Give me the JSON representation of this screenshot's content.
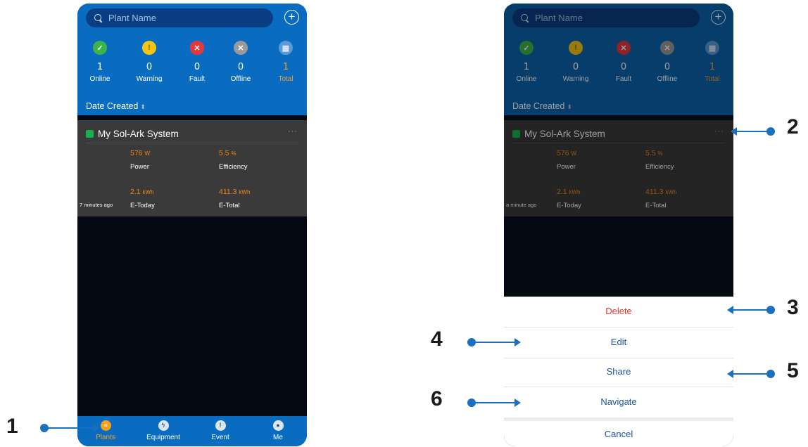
{
  "header": {
    "search_placeholder": "Plant Name",
    "add_icon": "plus-circle-icon"
  },
  "stats": [
    {
      "key": "online",
      "count": "1",
      "label": "Online",
      "icon": "check-icon",
      "color": "#3cb449"
    },
    {
      "key": "warning",
      "count": "0",
      "label": "Warning",
      "icon": "warning-icon",
      "color": "#f3c613"
    },
    {
      "key": "fault",
      "count": "0",
      "label": "Fault",
      "icon": "x-icon",
      "color": "#e5383b"
    },
    {
      "key": "offline",
      "count": "0",
      "label": "Offline",
      "icon": "x-icon",
      "color": "#9a9a9a"
    },
    {
      "key": "total",
      "count": "1",
      "label": "Total",
      "icon": "chart-icon",
      "color": "#5a9ad8"
    }
  ],
  "sort_label": "Date Created",
  "plant_left": {
    "name": "My Sol-Ark System",
    "menu": "···",
    "power_value": "576",
    "power_unit": "W",
    "power_label": "Power",
    "efficiency_value": "5.5",
    "efficiency_unit": "%",
    "efficiency_label": "Efficiency",
    "etoday_value": "2.1",
    "etoday_unit": "kWh",
    "etoday_label": "E-Today",
    "etotal_value": "411.3",
    "etotal_unit": "kWh",
    "etotal_label": "E-Total",
    "updated": "7 minutes ago"
  },
  "plant_right": {
    "name": "My Sol-Ark System",
    "menu": "···",
    "power_value": "576",
    "power_unit": "W",
    "power_label": "Power",
    "efficiency_value": "5.5",
    "efficiency_unit": "%",
    "efficiency_label": "Efficiency",
    "etoday_value": "2.1",
    "etoday_unit": "kWh",
    "etoday_label": "E-Today",
    "etotal_value": "411.3",
    "etotal_unit": "kWh",
    "etotal_label": "E-Total",
    "updated": "a minute ago"
  },
  "tabs": [
    {
      "label": "Plants",
      "icon": "plants-icon",
      "glyph": "≡",
      "active": true
    },
    {
      "label": "Equipment",
      "icon": "lightning-icon",
      "glyph": "ϟ",
      "active": false
    },
    {
      "label": "Event",
      "icon": "alert-icon",
      "glyph": "!",
      "active": false
    },
    {
      "label": "Me",
      "icon": "user-icon",
      "glyph": "●",
      "active": false
    }
  ],
  "action_sheet": {
    "delete": "Delete",
    "edit": "Edit",
    "share": "Share",
    "navigate": "Navigate",
    "cancel": "Cancel"
  },
  "callouts": {
    "c1": "1",
    "c2": "2",
    "c3": "3",
    "c4": "4",
    "c5": "5",
    "c6": "6"
  },
  "colors": {
    "header_blue": "#0a6cc1",
    "accent_orange": "#f4a21d",
    "callout_blue": "#1a6fbf",
    "delete_red": "#e0392f"
  }
}
